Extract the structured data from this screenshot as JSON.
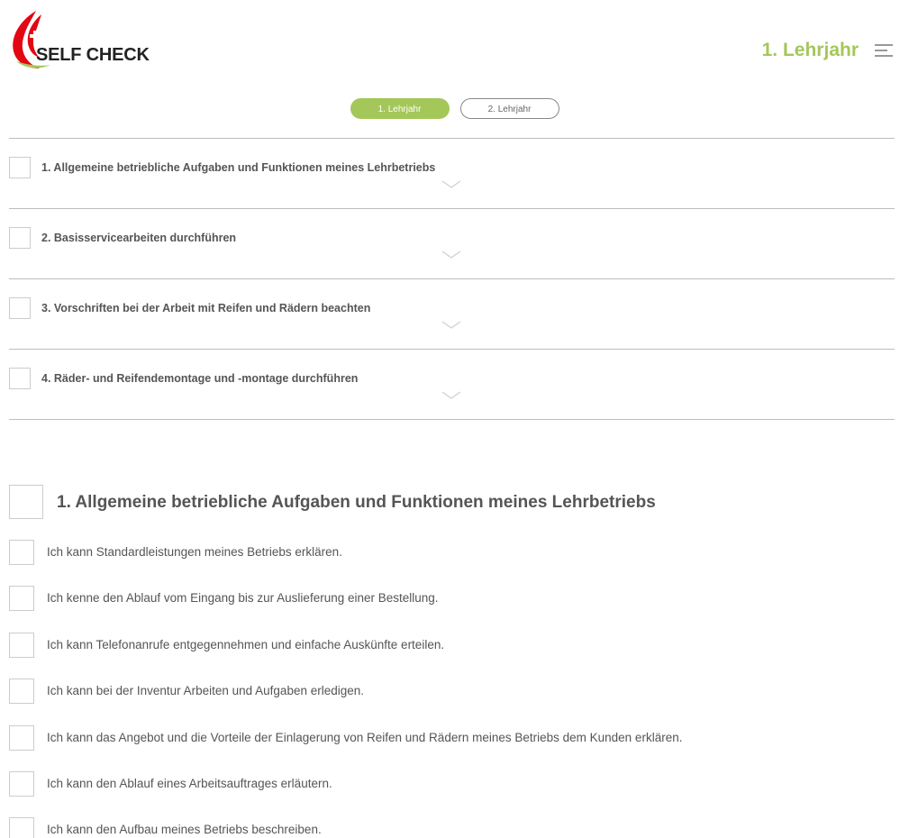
{
  "header": {
    "logo_text": "SELF CHECK",
    "year_title": "1. Lehrjahr",
    "menu_icon": "hamburger-menu-icon",
    "accent_color": "#a4c75a",
    "logo_colors": [
      "#e30613",
      "#a4c75a"
    ]
  },
  "tabs": [
    {
      "label": "1. Lehrjahr",
      "active": true
    },
    {
      "label": "2. Lehrjahr",
      "active": false
    }
  ],
  "accordion": [
    {
      "label": "1. Allgemeine betriebliche Aufgaben und Funktionen meines Lehrbetriebs",
      "checked": false,
      "icon": "chevron-down-icon"
    },
    {
      "label": "2. Basisservicearbeiten durchführen",
      "checked": false,
      "icon": "chevron-down-icon"
    },
    {
      "label": "3. Vorschriften bei der Arbeit mit Reifen und Rädern beachten",
      "checked": false,
      "icon": "chevron-down-icon"
    },
    {
      "label": "4. Räder- und Reifendemontage und -montage durchführen",
      "checked": false,
      "icon": "chevron-down-icon"
    }
  ],
  "section": {
    "title": "1. Allgemeine betriebliche Aufgaben und Funktionen meines Lehrbetriebs",
    "items": [
      {
        "label": "Ich kann Standardleistungen meines Betriebs erklären.",
        "checked": false
      },
      {
        "label": "Ich kenne den Ablauf vom Eingang bis zur Auslieferung einer Bestellung.",
        "checked": false
      },
      {
        "label": "Ich kann Telefonanrufe entgegennehmen und einfache Auskünfte erteilen.",
        "checked": false
      },
      {
        "label": "Ich kann bei der Inventur Arbeiten und Aufgaben erledigen.",
        "checked": false
      },
      {
        "label": "Ich kann das Angebot und die Vorteile der Einlagerung von Reifen und Rädern meines Betriebs dem Kunden erklären.",
        "checked": false
      },
      {
        "label": "Ich kann den Ablauf eines Arbeitsauftrages erläutern.",
        "checked": false
      },
      {
        "label": "Ich kann den Aufbau meines Betriebs beschreiben.",
        "checked": false
      }
    ]
  }
}
